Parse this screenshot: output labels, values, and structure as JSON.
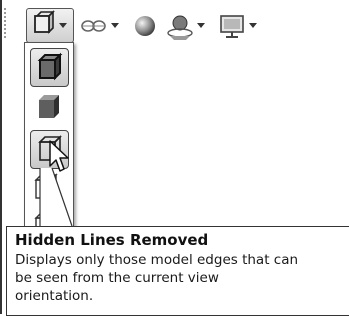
{
  "toolbar": {
    "items": [
      {
        "icon": "display-style-icon",
        "active": true,
        "has_dropdown": true
      },
      {
        "icon": "hide-show-items-icon",
        "has_dropdown": true
      },
      {
        "icon": "edit-appearance-icon"
      },
      {
        "icon": "apply-scene-icon",
        "has_dropdown": true
      },
      {
        "icon": "view-settings-icon",
        "has_dropdown": true
      }
    ]
  },
  "dropdown": {
    "items": [
      {
        "icon": "shaded-with-edges-icon"
      },
      {
        "icon": "shaded-icon"
      },
      {
        "icon": "hidden-lines-removed-icon",
        "selected": true
      },
      {
        "icon": "hidden-lines-visible-icon"
      },
      {
        "icon": "wireframe-icon"
      }
    ]
  },
  "tooltip": {
    "title": "Hidden Lines Removed",
    "line1": "Displays only those model edges that can",
    "line2": "be seen from the current view",
    "line3": "orientation."
  },
  "colors": {
    "border": "#555555",
    "selected_bg": "#d4d4d4",
    "text": "#111111"
  }
}
